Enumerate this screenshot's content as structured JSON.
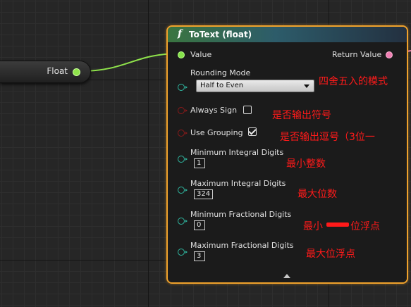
{
  "graph": {
    "float_node": {
      "label": "Float"
    },
    "node": {
      "title": "ToText (float)",
      "function_icon": "f",
      "pins": {
        "value_label": "Value",
        "return_label": "Return Value",
        "rounding_mode_label": "Rounding Mode",
        "rounding_mode_value": "Half to Even",
        "always_sign_label": "Always Sign",
        "always_sign_checked": false,
        "use_grouping_label": "Use Grouping",
        "use_grouping_checked": true,
        "min_integral_label": "Minimum Integral Digits",
        "min_integral_value": "1",
        "max_integral_label": "Maximum Integral Digits",
        "max_integral_value": "324",
        "min_fractional_label": "Minimum Fractional Digits",
        "min_fractional_value": "0",
        "max_fractional_label": "Maximum Fractional Digits",
        "max_fractional_value": "3"
      }
    }
  },
  "annotations": {
    "rounding": "四舍五入的模式",
    "always_sign": "是否输出符号",
    "use_grouping": "是否输出逗号（3位一",
    "min_integral": "最小整数",
    "max_integral": "最大位数",
    "min_fractional_a": "最小",
    "min_fractional_b": "位浮点",
    "max_fractional": "最大位浮点"
  },
  "colors": {
    "node_border": "#f0a22c",
    "float_pin": "#86e34a",
    "return_pin": "#f07fb3",
    "int_pin": "#2fb7a0",
    "bool_pin": "#8a1a1a",
    "annotation": "#ff1a1a"
  }
}
